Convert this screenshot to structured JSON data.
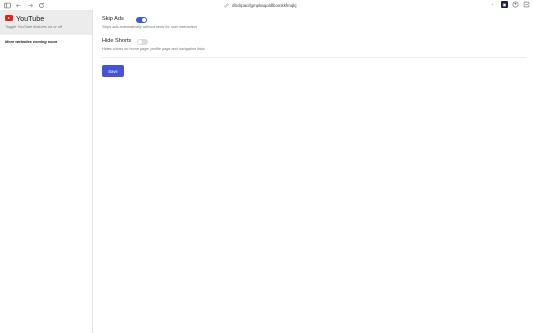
{
  "browser": {
    "url": "dbckpacifgmpkaqoldlbomkkfmqkj",
    "icons": [
      "sidebar-toggle-icon",
      "back-arrow-icon",
      "forward-arrow-icon",
      "reload-icon",
      "link-icon",
      "extension-icon",
      "puzzle-icon",
      "profile-icon",
      "menu-icon"
    ]
  },
  "sidebar": {
    "site_title": "YouTube",
    "site_description": "Toggle YouTube features on or off",
    "more_sites": "More websites coming soon"
  },
  "settings": [
    {
      "label": "Skip Ads",
      "description": "Skips ads automatically without need for user interaction",
      "enabled": true
    },
    {
      "label": "Hide Shorts",
      "description": "Hides shorts on home page, profile page and navigation links",
      "enabled": false
    }
  ],
  "actions": {
    "save_label": "Save"
  },
  "colors": {
    "accent": "#3a58d6",
    "button": "#4653d6",
    "youtube_red": "#e62117"
  }
}
